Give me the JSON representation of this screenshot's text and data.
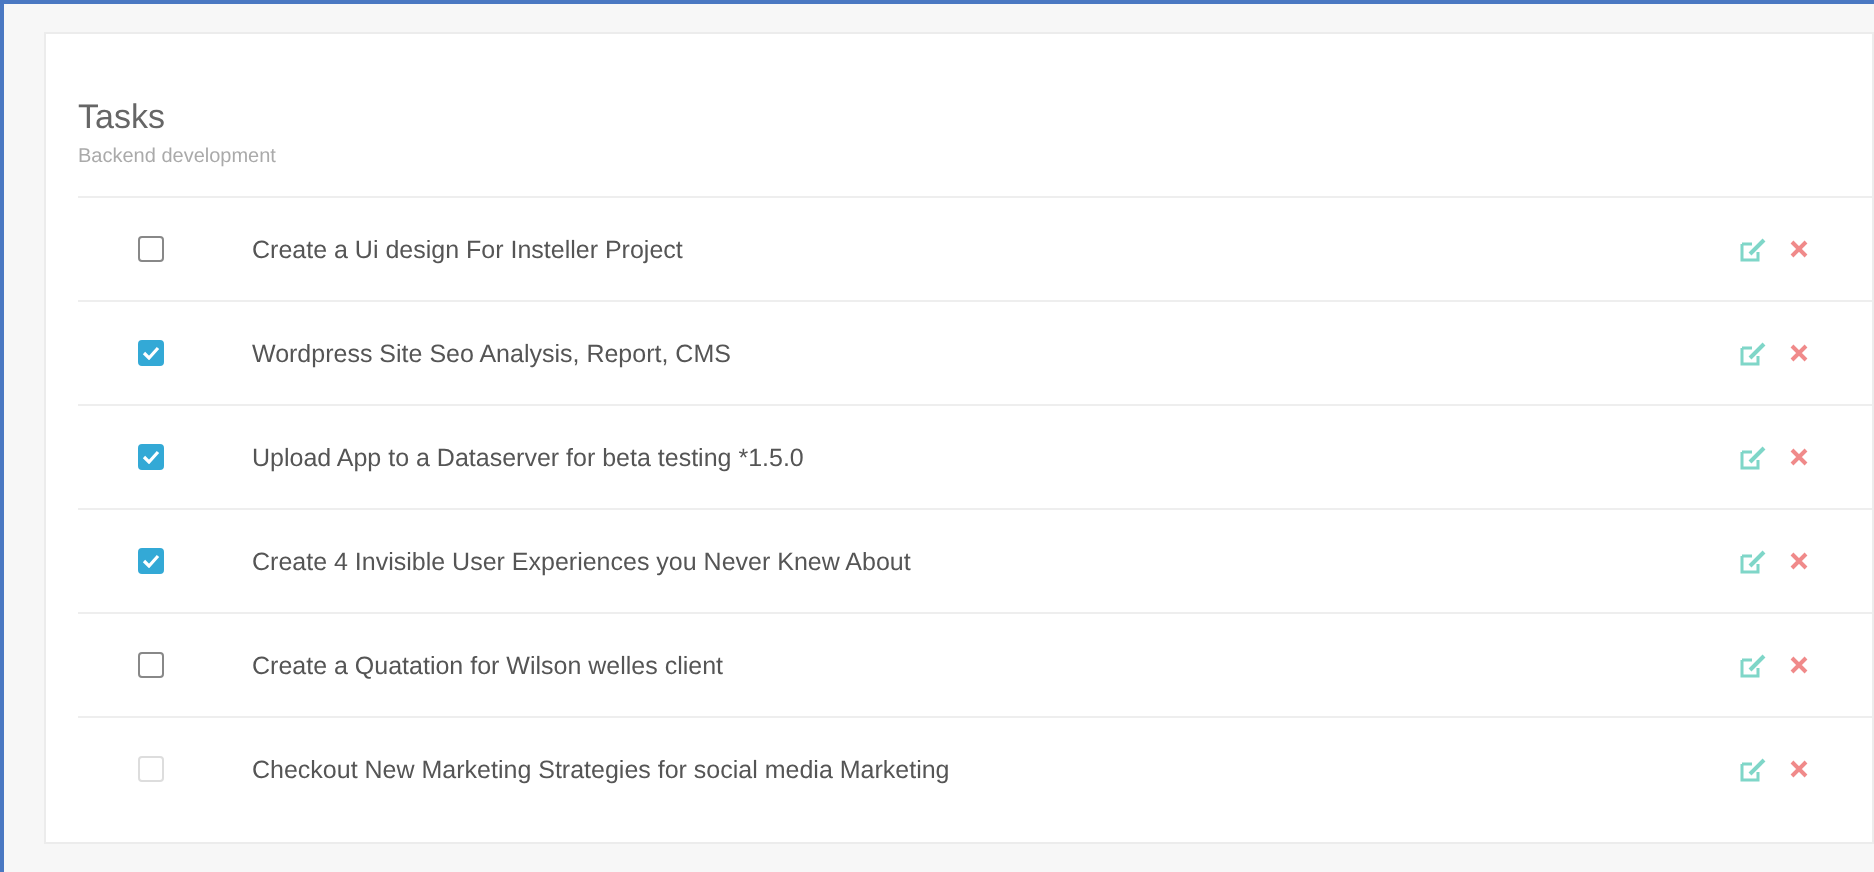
{
  "card": {
    "title": "Tasks",
    "subtitle": "Backend development"
  },
  "tasks": [
    {
      "label": "Create a Ui design For Insteller Project",
      "checked": false,
      "disabled": false
    },
    {
      "label": "Wordpress Site Seo Analysis, Report, CMS",
      "checked": true,
      "disabled": false
    },
    {
      "label": "Upload App to a Dataserver for beta testing *1.5.0",
      "checked": true,
      "disabled": false
    },
    {
      "label": "Create 4 Invisible User Experiences you Never Knew About",
      "checked": true,
      "disabled": false
    },
    {
      "label": "Create a Quatation for Wilson welles client",
      "checked": false,
      "disabled": false
    },
    {
      "label": "Checkout New Marketing Strategies for social media Marketing",
      "checked": false,
      "disabled": true
    }
  ]
}
